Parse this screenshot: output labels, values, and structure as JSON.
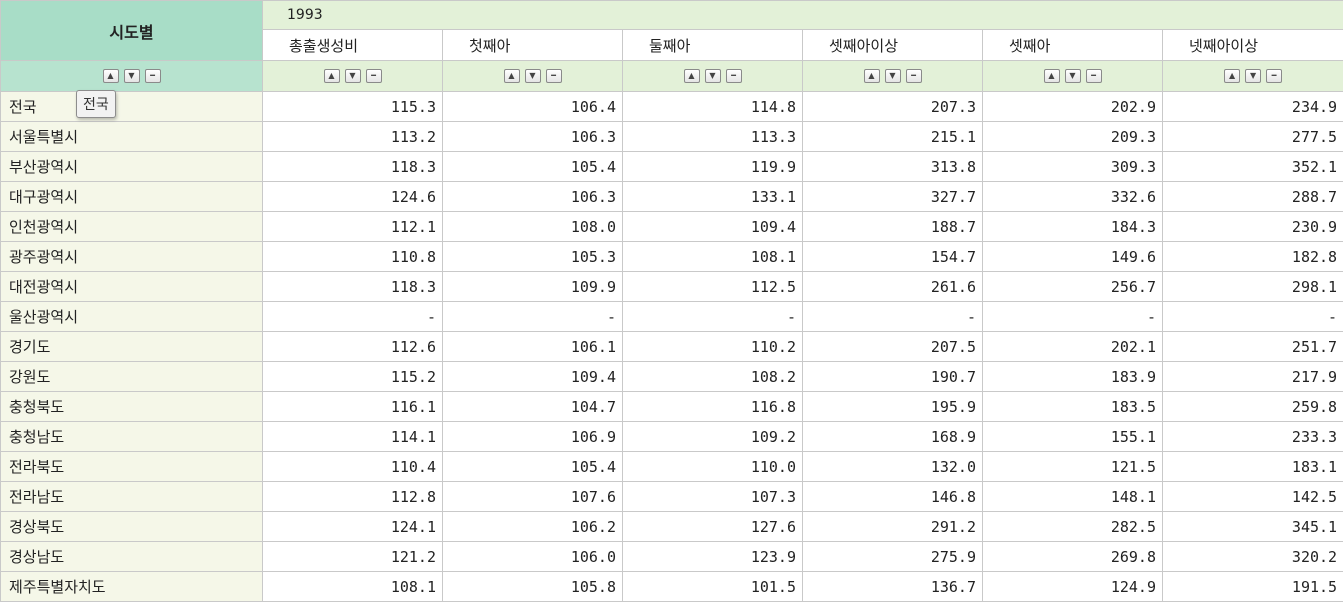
{
  "corner_label": "시도별",
  "year": "1993",
  "columns": [
    "총출생성비",
    "첫째아",
    "둘째아",
    "셋째아이상",
    "셋째아",
    "넷째아이상"
  ],
  "sort_icons": [
    "sort-up-icon",
    "sort-down-icon",
    "sort-clear-icon"
  ],
  "tooltip": "전국",
  "rows": [
    {
      "label": "전국",
      "values": [
        "115.3",
        "106.4",
        "114.8",
        "207.3",
        "202.9",
        "234.9"
      ]
    },
    {
      "label": "서울특별시",
      "values": [
        "113.2",
        "106.3",
        "113.3",
        "215.1",
        "209.3",
        "277.5"
      ]
    },
    {
      "label": "부산광역시",
      "values": [
        "118.3",
        "105.4",
        "119.9",
        "313.8",
        "309.3",
        "352.1"
      ]
    },
    {
      "label": "대구광역시",
      "values": [
        "124.6",
        "106.3",
        "133.1",
        "327.7",
        "332.6",
        "288.7"
      ]
    },
    {
      "label": "인천광역시",
      "values": [
        "112.1",
        "108.0",
        "109.4",
        "188.7",
        "184.3",
        "230.9"
      ]
    },
    {
      "label": "광주광역시",
      "values": [
        "110.8",
        "105.3",
        "108.1",
        "154.7",
        "149.6",
        "182.8"
      ]
    },
    {
      "label": "대전광역시",
      "values": [
        "118.3",
        "109.9",
        "112.5",
        "261.6",
        "256.7",
        "298.1"
      ]
    },
    {
      "label": "울산광역시",
      "values": [
        "-",
        "-",
        "-",
        "-",
        "-",
        "-"
      ]
    },
    {
      "label": "경기도",
      "values": [
        "112.6",
        "106.1",
        "110.2",
        "207.5",
        "202.1",
        "251.7"
      ]
    },
    {
      "label": "강원도",
      "values": [
        "115.2",
        "109.4",
        "108.2",
        "190.7",
        "183.9",
        "217.9"
      ]
    },
    {
      "label": "충청북도",
      "values": [
        "116.1",
        "104.7",
        "116.8",
        "195.9",
        "183.5",
        "259.8"
      ]
    },
    {
      "label": "충청남도",
      "values": [
        "114.1",
        "106.9",
        "109.2",
        "168.9",
        "155.1",
        "233.3"
      ]
    },
    {
      "label": "전라북도",
      "values": [
        "110.4",
        "105.4",
        "110.0",
        "132.0",
        "121.5",
        "183.1"
      ]
    },
    {
      "label": "전라남도",
      "values": [
        "112.8",
        "107.6",
        "107.3",
        "146.8",
        "148.1",
        "142.5"
      ]
    },
    {
      "label": "경상북도",
      "values": [
        "124.1",
        "106.2",
        "127.6",
        "291.2",
        "282.5",
        "345.1"
      ]
    },
    {
      "label": "경상남도",
      "values": [
        "121.2",
        "106.0",
        "123.9",
        "275.9",
        "269.8",
        "320.2"
      ]
    },
    {
      "label": "제주특별자치도",
      "values": [
        "108.1",
        "105.8",
        "101.5",
        "136.7",
        "124.9",
        "191.5"
      ]
    }
  ]
}
